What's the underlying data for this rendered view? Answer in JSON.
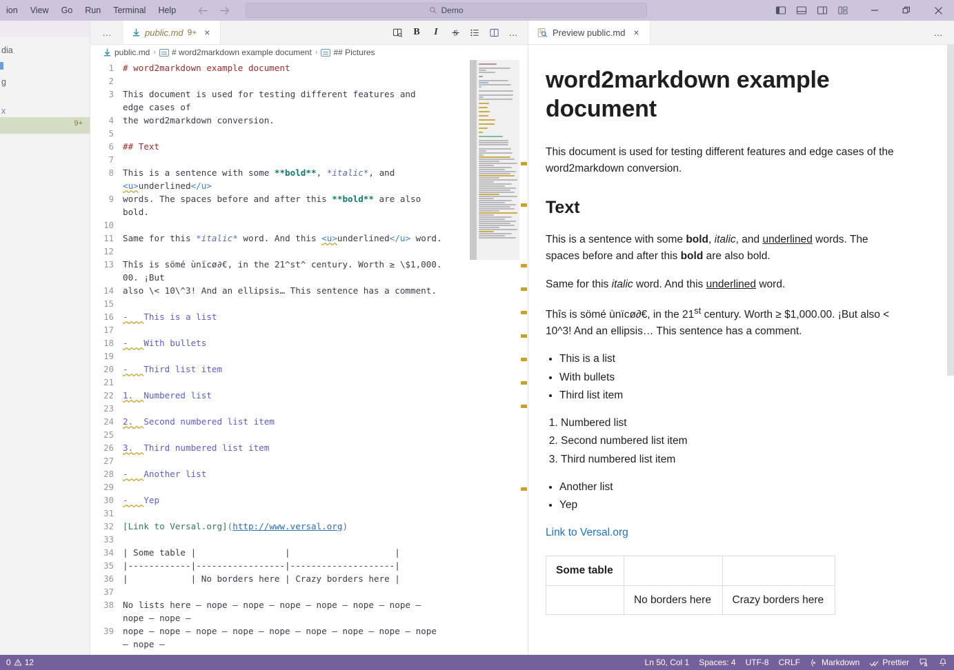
{
  "titlebar": {
    "menu": [
      "ion",
      "View",
      "Go",
      "Run",
      "Terminal",
      "Help"
    ],
    "search_value": "Demo",
    "back_icon": "arrow-left-icon",
    "forward_icon": "arrow-right-icon",
    "layout_icons": [
      "toggle-primary-sidebar-icon",
      "toggle-panel-icon",
      "toggle-secondary-sidebar-icon",
      "customize-layout-icon"
    ],
    "window_controls": [
      "minimize",
      "restore",
      "close"
    ]
  },
  "sidebar": {
    "rows": [
      "dia",
      "",
      "g",
      "",
      "x",
      ""
    ],
    "badge": "9+"
  },
  "tabbar": {
    "overflow_label": "…",
    "tab_label": "public.md",
    "tab_dirty": "9+",
    "close_label": "×",
    "actions": [
      {
        "name": "open-preview-to-side-icon",
        "label": "preview"
      },
      {
        "name": "bold-button",
        "label": "B"
      },
      {
        "name": "italic-button",
        "label": "I"
      },
      {
        "name": "strikethrough-button",
        "label": "S"
      },
      {
        "name": "bulleted-list-button",
        "label": "list"
      },
      {
        "name": "split-editor-button",
        "label": "split"
      },
      {
        "name": "more-actions-button",
        "label": "…"
      }
    ]
  },
  "breadcrumb": [
    {
      "icon": "markdown-file-icon",
      "label": "public.md"
    },
    {
      "icon": "symbol-string-icon",
      "label": "# word2markdown example document"
    },
    {
      "icon": "symbol-string-icon",
      "label": "## Pictures"
    }
  ],
  "editor": {
    "lines": [
      {
        "n": "1",
        "parts": [
          {
            "t": "# word2markdown example document",
            "c": "tok-head"
          }
        ]
      },
      {
        "n": "2",
        "parts": []
      },
      {
        "n": "3",
        "parts": [
          {
            "t": "This document is used for testing different features and",
            "c": ""
          }
        ]
      },
      {
        "n": "",
        "parts": [
          {
            "t": "edge cases of",
            "c": ""
          }
        ]
      },
      {
        "n": "4",
        "parts": [
          {
            "t": "the word2markdown conversion.",
            "c": ""
          }
        ]
      },
      {
        "n": "5",
        "parts": []
      },
      {
        "n": "6",
        "parts": [
          {
            "t": "## Text",
            "c": "tok-head"
          }
        ]
      },
      {
        "n": "7",
        "parts": []
      },
      {
        "n": "8",
        "parts": [
          {
            "t": "This is a sentence with some ",
            "c": ""
          },
          {
            "t": "**bold**",
            "c": "tok-bold"
          },
          {
            "t": ", ",
            "c": ""
          },
          {
            "t": "*italic*",
            "c": "tok-ital"
          },
          {
            "t": ", and",
            "c": ""
          }
        ]
      },
      {
        "n": "",
        "parts": [
          {
            "t": "<u>",
            "c": "tok-html tok-ul"
          },
          {
            "t": "underlined",
            "c": ""
          },
          {
            "t": "</u>",
            "c": "tok-html"
          }
        ]
      },
      {
        "n": "9",
        "parts": [
          {
            "t": "words. The spaces before and after this ",
            "c": ""
          },
          {
            "t": "**bold**",
            "c": "tok-bold"
          },
          {
            "t": " are also",
            "c": ""
          }
        ]
      },
      {
        "n": "",
        "parts": [
          {
            "t": "bold.",
            "c": ""
          }
        ]
      },
      {
        "n": "10",
        "parts": []
      },
      {
        "n": "11",
        "parts": [
          {
            "t": "Same for this ",
            "c": ""
          },
          {
            "t": "*italic*",
            "c": "tok-ital"
          },
          {
            "t": " word. And this ",
            "c": ""
          },
          {
            "t": "<u>",
            "c": "tok-html tok-ul"
          },
          {
            "t": "underlined",
            "c": ""
          },
          {
            "t": "</u>",
            "c": "tok-html"
          },
          {
            "t": " word.",
            "c": ""
          }
        ]
      },
      {
        "n": "12",
        "parts": []
      },
      {
        "n": "13",
        "parts": [
          {
            "t": "Thîs is sömé ùnïcø∂€, in the 21^st^ century. Worth ≥ \\$1,000.",
            "c": ""
          }
        ]
      },
      {
        "n": "",
        "parts": [
          {
            "t": "00. ¡But",
            "c": ""
          }
        ]
      },
      {
        "n": "14",
        "parts": [
          {
            "t": "also \\< 10\\^3! And an ellipsis… This sentence has a comment.",
            "c": ""
          }
        ]
      },
      {
        "n": "15",
        "parts": []
      },
      {
        "n": "16",
        "parts": [
          {
            "t": "-",
            "c": "tok-marker"
          },
          {
            "t": "   ",
            "c": "tok-marker"
          },
          {
            "t": "This is a list",
            "c": "tok-list"
          }
        ]
      },
      {
        "n": "17",
        "parts": []
      },
      {
        "n": "18",
        "parts": [
          {
            "t": "-",
            "c": "tok-marker"
          },
          {
            "t": "   ",
            "c": "tok-marker"
          },
          {
            "t": "With bullets",
            "c": "tok-list"
          }
        ]
      },
      {
        "n": "19",
        "parts": []
      },
      {
        "n": "20",
        "parts": [
          {
            "t": "-",
            "c": "tok-marker"
          },
          {
            "t": "   ",
            "c": "tok-marker"
          },
          {
            "t": "Third list item",
            "c": "tok-list"
          }
        ]
      },
      {
        "n": "21",
        "parts": []
      },
      {
        "n": "22",
        "parts": [
          {
            "t": "1.",
            "c": "tok-marker"
          },
          {
            "t": "  ",
            "c": "tok-marker"
          },
          {
            "t": "Numbered list",
            "c": "tok-list"
          }
        ]
      },
      {
        "n": "23",
        "parts": []
      },
      {
        "n": "24",
        "parts": [
          {
            "t": "2.",
            "c": "tok-marker"
          },
          {
            "t": "  ",
            "c": "tok-marker"
          },
          {
            "t": "Second numbered list item",
            "c": "tok-list"
          }
        ]
      },
      {
        "n": "25",
        "parts": []
      },
      {
        "n": "26",
        "parts": [
          {
            "t": "3.",
            "c": "tok-marker"
          },
          {
            "t": "  ",
            "c": "tok-marker"
          },
          {
            "t": "Third numbered list item",
            "c": "tok-list"
          }
        ]
      },
      {
        "n": "27",
        "parts": []
      },
      {
        "n": "28",
        "parts": [
          {
            "t": "-",
            "c": "tok-marker"
          },
          {
            "t": "   ",
            "c": "tok-marker"
          },
          {
            "t": "Another list",
            "c": "tok-list"
          }
        ]
      },
      {
        "n": "29",
        "parts": []
      },
      {
        "n": "30",
        "parts": [
          {
            "t": "-",
            "c": "tok-marker"
          },
          {
            "t": "   ",
            "c": "tok-marker"
          },
          {
            "t": "Yep",
            "c": "tok-list"
          }
        ]
      },
      {
        "n": "31",
        "parts": []
      },
      {
        "n": "32",
        "parts": [
          {
            "t": "[Link to Versal.org]",
            "c": "tok-linktext"
          },
          {
            "t": "(",
            "c": "tok-punct"
          },
          {
            "t": "http://www.versal.org",
            "c": "tok-url"
          },
          {
            "t": ")",
            "c": "tok-punct"
          }
        ]
      },
      {
        "n": "33",
        "parts": []
      },
      {
        "n": "34",
        "parts": [
          {
            "t": "| Some table |                 |                    |",
            "c": ""
          }
        ]
      },
      {
        "n": "35",
        "parts": [
          {
            "t": "|------------|-----------------|--------------------|",
            "c": ""
          }
        ]
      },
      {
        "n": "36",
        "parts": [
          {
            "t": "|            | No borders here | Crazy borders here |",
            "c": ""
          }
        ]
      },
      {
        "n": "37",
        "parts": []
      },
      {
        "n": "38",
        "parts": [
          {
            "t": "No lists here – nope – nope – nope – nope – nope – nope –",
            "c": ""
          }
        ]
      },
      {
        "n": "",
        "parts": [
          {
            "t": "nope – nope –",
            "c": ""
          }
        ]
      },
      {
        "n": "39",
        "parts": [
          {
            "t": "nope – nope – nope – nope – nope – nope – nope – nope – nope",
            "c": ""
          }
        ]
      },
      {
        "n": "",
        "parts": [
          {
            "t": "– nope –",
            "c": ""
          }
        ]
      }
    ]
  },
  "preview": {
    "tab_label": "Preview public.md",
    "tab_icon": "preview-icon",
    "close_label": "×",
    "more_label": "…",
    "h1": "word2markdown example document",
    "intro": "This document is used for testing different features and edge cases of the word2markdown conversion.",
    "h2": "Text",
    "p1": {
      "a": "This is a sentence with some ",
      "bold1": "bold",
      "b": ", ",
      "italic1": "italic",
      "c": ", and ",
      "under1": "underlined",
      "d": " words. The spaces before and after this ",
      "bold2": "bold",
      "e": " are also bold."
    },
    "p2": {
      "a": "Same for this ",
      "italic": "italic",
      "b": " word. And this ",
      "under": "underlined",
      "c": " word."
    },
    "p3": {
      "a": "Thîs is sömé ùnïcø∂€, in the 21",
      "sup": "st",
      "b": " century. Worth ≥ $1,000.00. ¡But also < 10^3! And an ellipsis… This sentence has a comment."
    },
    "bullets1": [
      "This is a list",
      "With bullets",
      "Third list item"
    ],
    "numbered": [
      "Numbered list",
      "Second numbered list item",
      "Third numbered list item"
    ],
    "bullets2": [
      "Another list",
      "Yep"
    ],
    "link": "Link to Versal.org",
    "table": {
      "row1": [
        "Some table",
        "",
        ""
      ],
      "row2": [
        "",
        "No borders here",
        "Crazy borders here"
      ]
    }
  },
  "statusbar": {
    "errors": "0",
    "warnings": "12",
    "position": "Ln 50, Col 1",
    "spaces": "Spaces: 4",
    "encoding": "UTF-8",
    "eol": "CRLF",
    "language": "Markdown",
    "formatter": "Prettier",
    "feedback_icon": "feedback-icon",
    "bell_icon": "bell-icon"
  },
  "colors": {
    "titlebar": "#cdc5dc",
    "statusbar": "#74609a",
    "heading": "#9d2b2b",
    "bold": "#0f7a6b",
    "list": "#5b5bd6",
    "link": "#2b6cb8",
    "preview_link": "#1a72c4",
    "tab_text": "#8a7a3e"
  }
}
